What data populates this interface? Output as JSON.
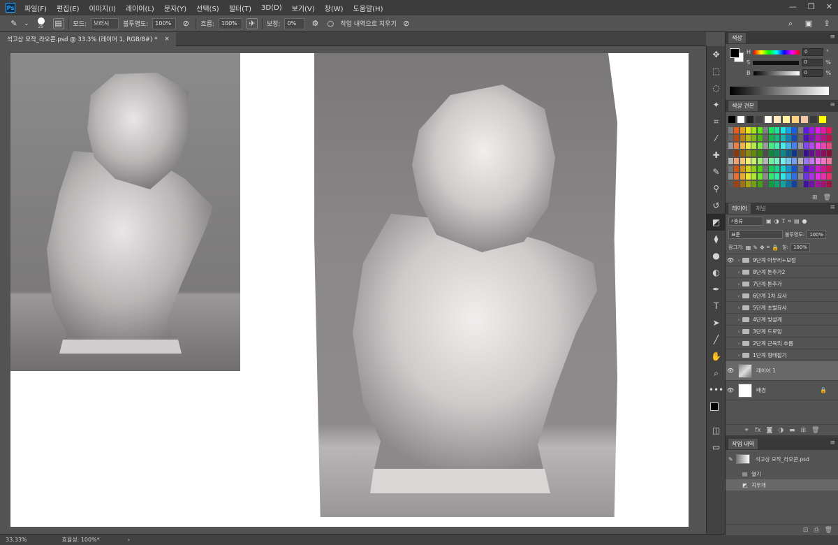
{
  "menubar": {
    "logo": "Ps",
    "items": [
      "파일(F)",
      "편집(E)",
      "이미지(I)",
      "레이어(L)",
      "문자(Y)",
      "선택(S)",
      "필터(T)",
      "3D(D)",
      "보기(V)",
      "창(W)",
      "도움말(H)"
    ],
    "win_minimize": "—",
    "win_restore": "❐",
    "win_close": "✕"
  },
  "options": {
    "brush_size": "25",
    "mode_label": "모드:",
    "mode_value": "브러시",
    "opacity_label": "불투명도:",
    "opacity_value": "100%",
    "flow_label": "흐름:",
    "flow_value": "100%",
    "smoothing_label": "보정:",
    "smoothing_value": "0%",
    "erase_history_label": "작업 내역으로 지우기"
  },
  "document_tab": {
    "title": "석고상 모작_라오콘.psd @ 33.3% (레이어 1, RGB/8#) *",
    "close": "×"
  },
  "statusbar": {
    "zoom": "33.33%",
    "efficiency": "효율성: 100%*"
  },
  "color_panel": {
    "title": "색상",
    "channels": [
      {
        "label": "H",
        "value": "0",
        "unit": "°"
      },
      {
        "label": "S",
        "value": "0",
        "unit": "%"
      },
      {
        "label": "B",
        "value": "0",
        "unit": "%"
      }
    ],
    "foreground_color": "#000000",
    "background_color": "#ffffff"
  },
  "swatches_panel": {
    "title": "색상 견본"
  },
  "layers_panel": {
    "tabs": [
      "레이어",
      "채널"
    ],
    "filter_label": "종류",
    "blend_mode": "표준",
    "opacity_label": "불투명도:",
    "opacity_value": "100%",
    "lock_label": "잠그기:",
    "fill_label": "칠:",
    "fill_value": "100%",
    "layers": [
      {
        "name": "9단계 마무리+보정",
        "type": "group",
        "visible": true
      },
      {
        "name": "8단계 톤추가2",
        "type": "group",
        "visible": false
      },
      {
        "name": "7단계 톤추가",
        "type": "group",
        "visible": false
      },
      {
        "name": "6단계 1차 묘사",
        "type": "group",
        "visible": false
      },
      {
        "name": "5단계 초벌묘사",
        "type": "group",
        "visible": false
      },
      {
        "name": "4단계 빛설계",
        "type": "group",
        "visible": false
      },
      {
        "name": "3단계 드로잉",
        "type": "group",
        "visible": false
      },
      {
        "name": "2단계 근육의 흐름",
        "type": "group",
        "visible": false
      },
      {
        "name": "1단계 형태잡기",
        "type": "group",
        "visible": false
      },
      {
        "name": "레이어 1",
        "type": "layer",
        "visible": true,
        "selected": true
      },
      {
        "name": "배경",
        "type": "background",
        "visible": true
      }
    ]
  },
  "history_panel": {
    "title": "작업 내역",
    "snapshot": "석고상 모작_라오콘.psd",
    "items": [
      {
        "name": "열기",
        "selected": false
      },
      {
        "name": "지우개",
        "selected": true
      }
    ]
  }
}
